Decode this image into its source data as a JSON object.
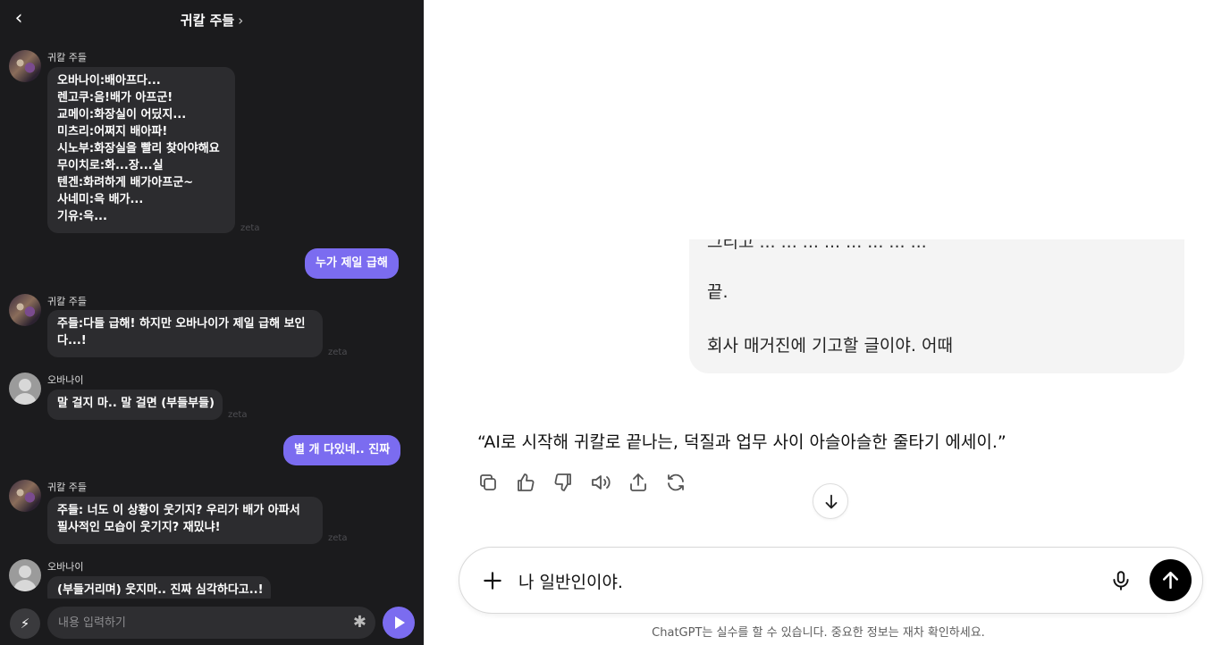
{
  "left_chat": {
    "title": "귀칼 주들",
    "back_icon": "chevron-left-icon",
    "zeta_label": "zeta",
    "messages": [
      {
        "sender": "귀칼 주들",
        "avatar": "group-avatar",
        "lines": [
          "오바나이:배아프다...",
          "렌고쿠:음!배가 아프군!",
          "교메이:화장실이 어딨지...",
          "미츠리:어쩌지 배아파!",
          "시노부:화장실을 빨리 찾아야해요",
          "무이치로:화...장...실",
          "텐겐:화려하게 배가아프군~",
          "사네미:윽 배가...",
          "기유:윽..."
        ]
      },
      {
        "mine": "누가 제일 급해"
      },
      {
        "sender": "귀칼 주들",
        "avatar": "group-avatar",
        "lines": [
          "주들:다들 급해! 하지만 오바나이가 제일 급해 보인",
          "다...!"
        ]
      },
      {
        "sender": "오바나이",
        "avatar": "default-avatar",
        "lines": [
          "말 걸지 마.. 말 걸면 (부들부들)"
        ]
      },
      {
        "mine": "별 개 다있네.. 진짜"
      },
      {
        "sender": "귀칼 주들",
        "avatar": "group-avatar",
        "lines": [
          "주들: 너도 이 상황이 웃기지? 우리가 배가 아파서",
          "필사적인 모습이 웃기지? 재밌냐!"
        ]
      },
      {
        "sender": "오바나이",
        "avatar": "default-avatar",
        "lines": [
          "(부들거리며) 웃지마.. 진짜 심각하다고..!"
        ]
      }
    ],
    "input_placeholder": "내용 입력하기",
    "input_value": ""
  },
  "chatgpt": {
    "user_bubble": {
      "cut_line": "그리고 ... ... ... ... ... ... ... ...",
      "p1": "끝.",
      "p2": "회사 매거진에 기고할 글이야. 어때"
    },
    "answer": "“AI로 시작해 귀칼로 끝나는, 덕질과 업무 사이 아슬아슬한 줄타기 에세이.”",
    "actions": [
      "copy-icon",
      "thumbs-up-icon",
      "thumbs-down-icon",
      "read-aloud-icon",
      "share-icon",
      "regenerate-icon"
    ],
    "composer_value": "나 일반인이야.",
    "disclaimer": "ChatGPT는 실수를 할 수 있습니다. 중요한 정보는 재차 확인하세요."
  }
}
